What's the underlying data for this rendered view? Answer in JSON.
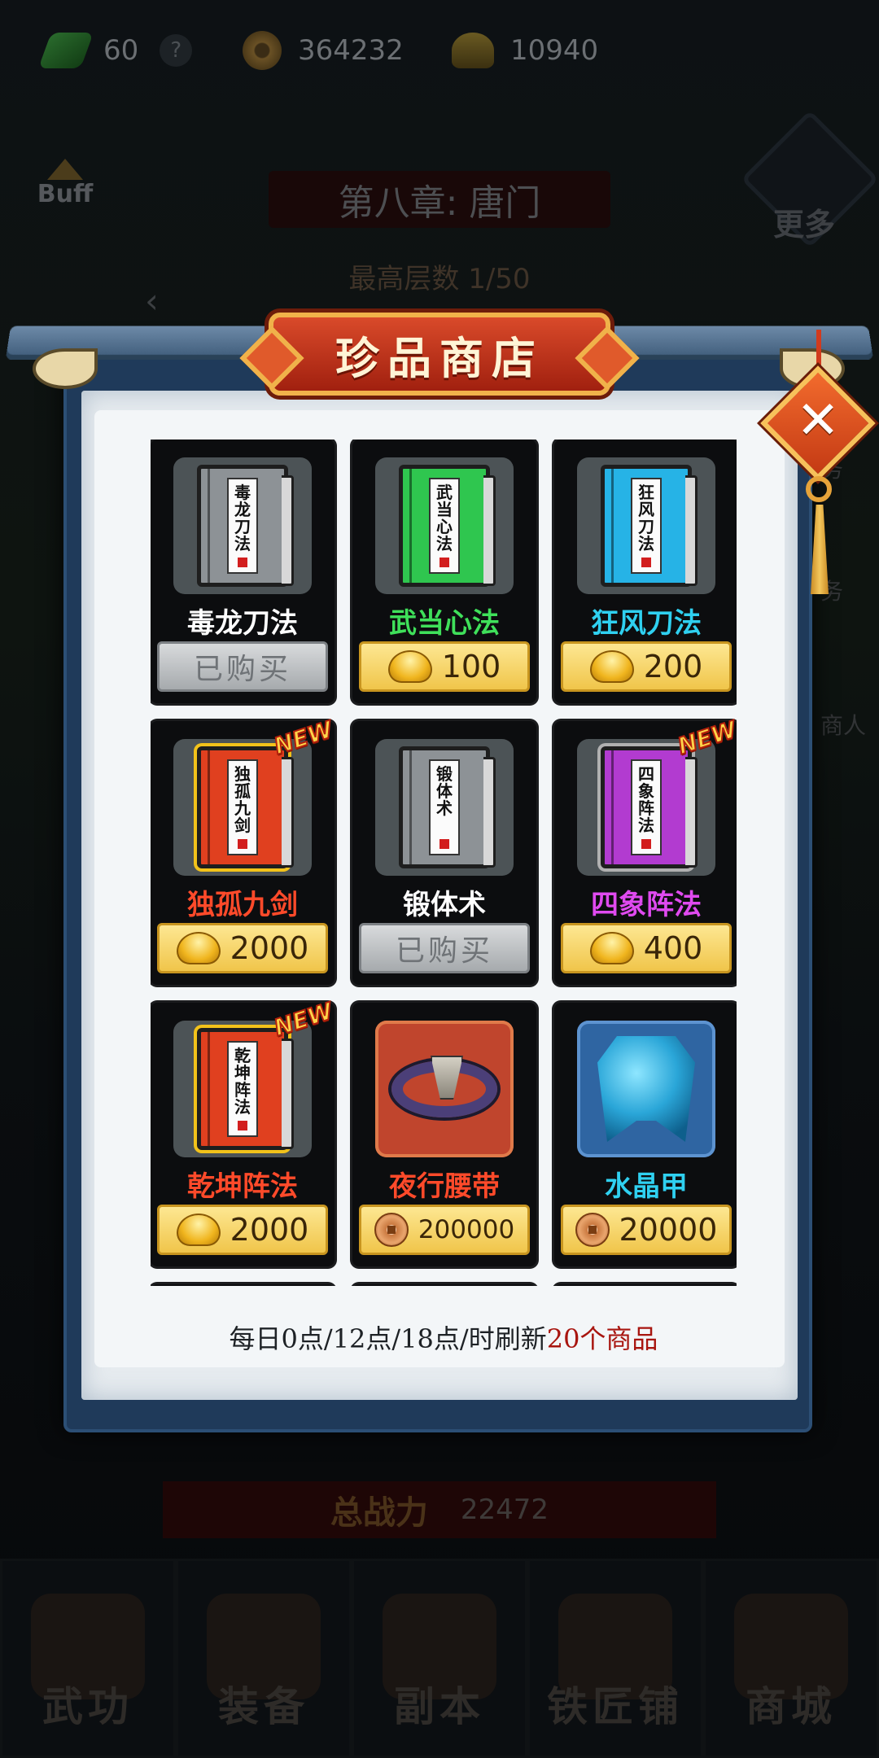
{
  "resources": {
    "stamina": "60",
    "help": "?",
    "coins": "364232",
    "ingots": "10940"
  },
  "background": {
    "buff_label": "Buff",
    "chapter_title": "第八章: 唐门",
    "floor_progress": "最高层数 1/50",
    "more_label": "更多",
    "back_arrow": "‹",
    "side_tasks": [
      "务",
      "务",
      "商人"
    ],
    "power_label": "总战力",
    "power_value": "22472",
    "nav": [
      "武功",
      "装备",
      "副本",
      "铁匠铺",
      "商城"
    ]
  },
  "shop": {
    "title": "珍品商店",
    "close_symbol": "✕",
    "new_label": "NEW",
    "bought_label": "已购买",
    "refresh_text": "每日0点/12点/18点/时刷新",
    "refresh_highlight": "20个商品",
    "items": [
      {
        "name": "毒龙刀法",
        "book_title": [
          "毒",
          "龙",
          "刀",
          "法"
        ],
        "price": "已购买",
        "currency": "none",
        "name_color": "#ffffff",
        "book_color": "gray",
        "is_new": false,
        "bought": true
      },
      {
        "name": "武当心法",
        "book_title": [
          "武",
          "当",
          "心",
          "法"
        ],
        "price": "100",
        "currency": "ingot",
        "name_color": "#3fe05a",
        "book_color": "green",
        "is_new": false,
        "bought": false
      },
      {
        "name": "狂风刀法",
        "book_title": [
          "狂",
          "风",
          "刀",
          "法"
        ],
        "price": "200",
        "currency": "ingot",
        "name_color": "#2fd0f0",
        "book_color": "cyan",
        "is_new": false,
        "bought": false
      },
      {
        "name": "独孤九剑",
        "book_title": [
          "独",
          "孤",
          "九",
          "剑"
        ],
        "price": "2000",
        "currency": "ingot",
        "name_color": "#ff4a2a",
        "book_color": "red",
        "is_new": true,
        "bought": false
      },
      {
        "name": "锻体术",
        "book_title": [
          "锻",
          "体",
          "术"
        ],
        "price": "已购买",
        "currency": "none",
        "name_color": "#ffffff",
        "book_color": "gray",
        "is_new": false,
        "bought": true
      },
      {
        "name": "四象阵法",
        "book_title": [
          "四",
          "象",
          "阵",
          "法"
        ],
        "price": "400",
        "currency": "ingot",
        "name_color": "#e04af0",
        "book_color": "purple",
        "is_new": true,
        "bought": false
      },
      {
        "name": "乾坤阵法",
        "book_title": [
          "乾",
          "坤",
          "阵",
          "法"
        ],
        "price": "2000",
        "currency": "ingot",
        "name_color": "#ff4a2a",
        "book_color": "red",
        "is_new": true,
        "bought": false
      },
      {
        "name": "夜行腰带",
        "book_title": [],
        "price": "200000",
        "currency": "coin",
        "name_color": "#ff4a2a",
        "book_color": "belt",
        "is_new": false,
        "bought": false
      },
      {
        "name": "水晶甲",
        "book_title": [],
        "price": "20000",
        "currency": "coin",
        "name_color": "#2fd0f0",
        "book_color": "armor",
        "is_new": false,
        "bought": false
      }
    ]
  }
}
